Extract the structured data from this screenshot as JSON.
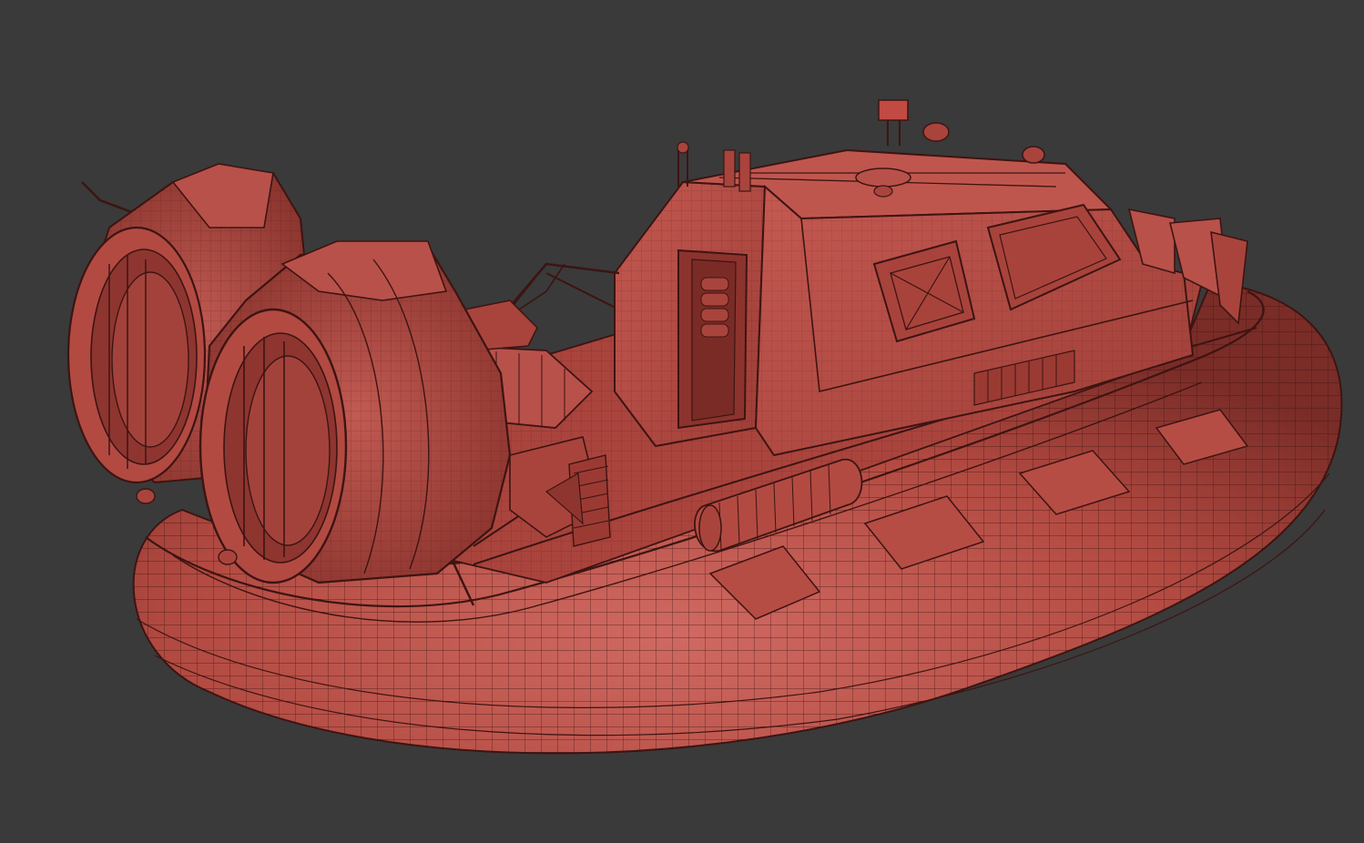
{
  "scene": {
    "subject": "hovercraft-wireframe-model",
    "colors": {
      "background": "#3a3a3a",
      "body": "#b5483f",
      "body_light": "#c9605a",
      "body_dark": "#7d2e2a",
      "wire": "#3d1412"
    }
  }
}
